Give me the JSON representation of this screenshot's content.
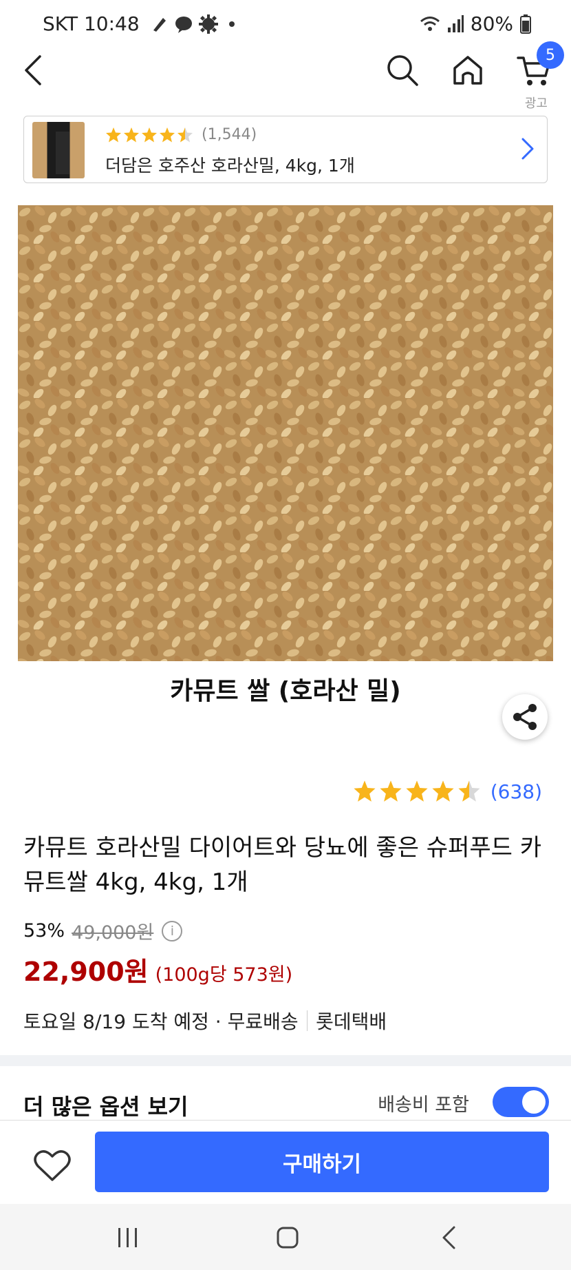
{
  "status_bar": {
    "carrier_time": "SKT 10:48",
    "battery": "80%"
  },
  "header": {
    "cart_count": "5",
    "ad_label": "광고"
  },
  "sticky_product": {
    "rating": 4.5,
    "review_count": "(1,544)",
    "title": "더담은 호주산 호라산밀, 4kg, 1개"
  },
  "product": {
    "image_caption": "카뮤트 쌀 (호라산 밀)",
    "rating": 4.5,
    "review_count": "(638)",
    "title": "카뮤트 호라산밀 다이어트와 당뇨에 좋은 슈퍼푸드 카뮤트쌀 4kg, 4kg, 1개"
  },
  "price": {
    "discount_rate": "53%",
    "original_price": "49,000원",
    "sale_price": "22,900원",
    "unit_price": "(100g당 573원)"
  },
  "delivery": {
    "arrival": "토요일 8/19 도착 예정 · 무료배송",
    "carrier": "롯데택배"
  },
  "options": {
    "title": "더 많은 옵션 보기",
    "shipping_toggle_label": "배송비 포함",
    "shipping_toggle_on": true
  },
  "actions": {
    "buy_label": "구매하기"
  },
  "colors": {
    "accent": "#346aff",
    "price": "#ae0000",
    "star": "#f8b41b"
  }
}
